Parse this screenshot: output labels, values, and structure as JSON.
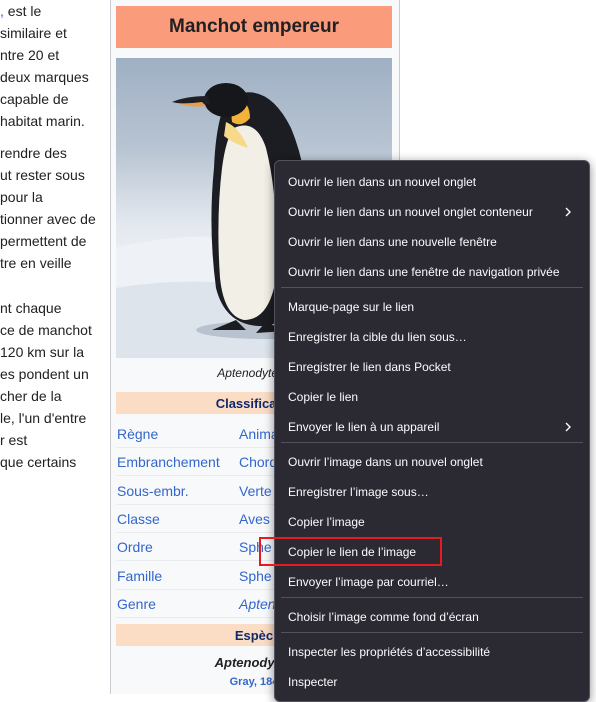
{
  "article_lines": [
    {
      "link": ",",
      "text": " est le"
    },
    {
      "text": "similaire et"
    },
    {
      "text": "ntre 20 et"
    },
    {
      "text": "deux marques"
    },
    {
      "text": "capable de"
    },
    {
      "text": "habitat marin."
    },
    {
      "text": "rendre des"
    },
    {
      "text": "ut rester sous"
    },
    {
      "text": "pour la"
    },
    {
      "text": "tionner avec de"
    },
    {
      "text": "permettent de"
    },
    {
      "text": "tre en veille"
    },
    {
      "text": "nt chaque"
    },
    {
      "text": "ce de manchot"
    },
    {
      "text": "120 km sur la"
    },
    {
      "text": "es pondent un"
    },
    {
      "text": "cher de la"
    },
    {
      "text": "le, l'un d'entre"
    },
    {
      "text": "r est"
    },
    {
      "text": "que certains"
    }
  ],
  "infobox": {
    "title": "Manchot empereur",
    "caption": "Aptenodytes f",
    "classification_header": "Classificatio",
    "taxonomy": [
      {
        "label": "Règne",
        "value": "Anima",
        "italic": false
      },
      {
        "label": "Embranchement",
        "value": "Chord",
        "italic": false
      },
      {
        "label": "Sous-embr.",
        "value": "Verte",
        "italic": false
      },
      {
        "label": "Classe",
        "value": "Aves",
        "italic": false
      },
      {
        "label": "Ordre",
        "value": "Sphe",
        "italic": false
      },
      {
        "label": "Famille",
        "value": "Sphe",
        "italic": false
      },
      {
        "label": "Genre",
        "value": "Apten",
        "italic": true
      }
    ],
    "species_header": "Espèc",
    "species_name": "Aptenodytes",
    "species_author": "Gray, 184"
  },
  "context_menu": {
    "items": [
      {
        "label": "Ouvrir le lien dans un nouvel onglet",
        "submenu": false
      },
      {
        "label": "Ouvrir le lien dans un nouvel onglet conteneur",
        "submenu": true
      },
      {
        "label": "Ouvrir le lien dans une nouvelle fenêtre",
        "submenu": false
      },
      {
        "label": "Ouvrir le lien dans une fenêtre de navigation privée",
        "submenu": false
      },
      {
        "label": "Marque-page sur le lien",
        "submenu": false
      },
      {
        "label": "Enregistrer la cible du lien sous…",
        "submenu": false
      },
      {
        "label": "Enregistrer le lien dans Pocket",
        "submenu": false
      },
      {
        "label": "Copier le lien",
        "submenu": false
      },
      {
        "label": "Envoyer le lien à un appareil",
        "submenu": true
      },
      {
        "label": "Ouvrir l’image dans un nouvel onglet",
        "submenu": false
      },
      {
        "label": "Enregistrer l’image sous…",
        "submenu": false
      },
      {
        "label": "Copier l’image",
        "submenu": false
      },
      {
        "label": "Copier le lien de l’image",
        "submenu": false,
        "highlighted": true
      },
      {
        "label": "Envoyer l’image par courriel…",
        "submenu": false
      },
      {
        "label": "Choisir l’image comme fond d’écran",
        "submenu": false
      },
      {
        "label": "Inspecter les propriétés d’accessibilité",
        "submenu": false
      },
      {
        "label": "Inspecter",
        "submenu": false
      }
    ],
    "highlight_color": "#e41c22"
  },
  "colors": {
    "title_bg": "#fa9b7c",
    "section_bg": "#fbddc6",
    "link": "#3366cc",
    "menu_bg": "#2b2a33"
  }
}
